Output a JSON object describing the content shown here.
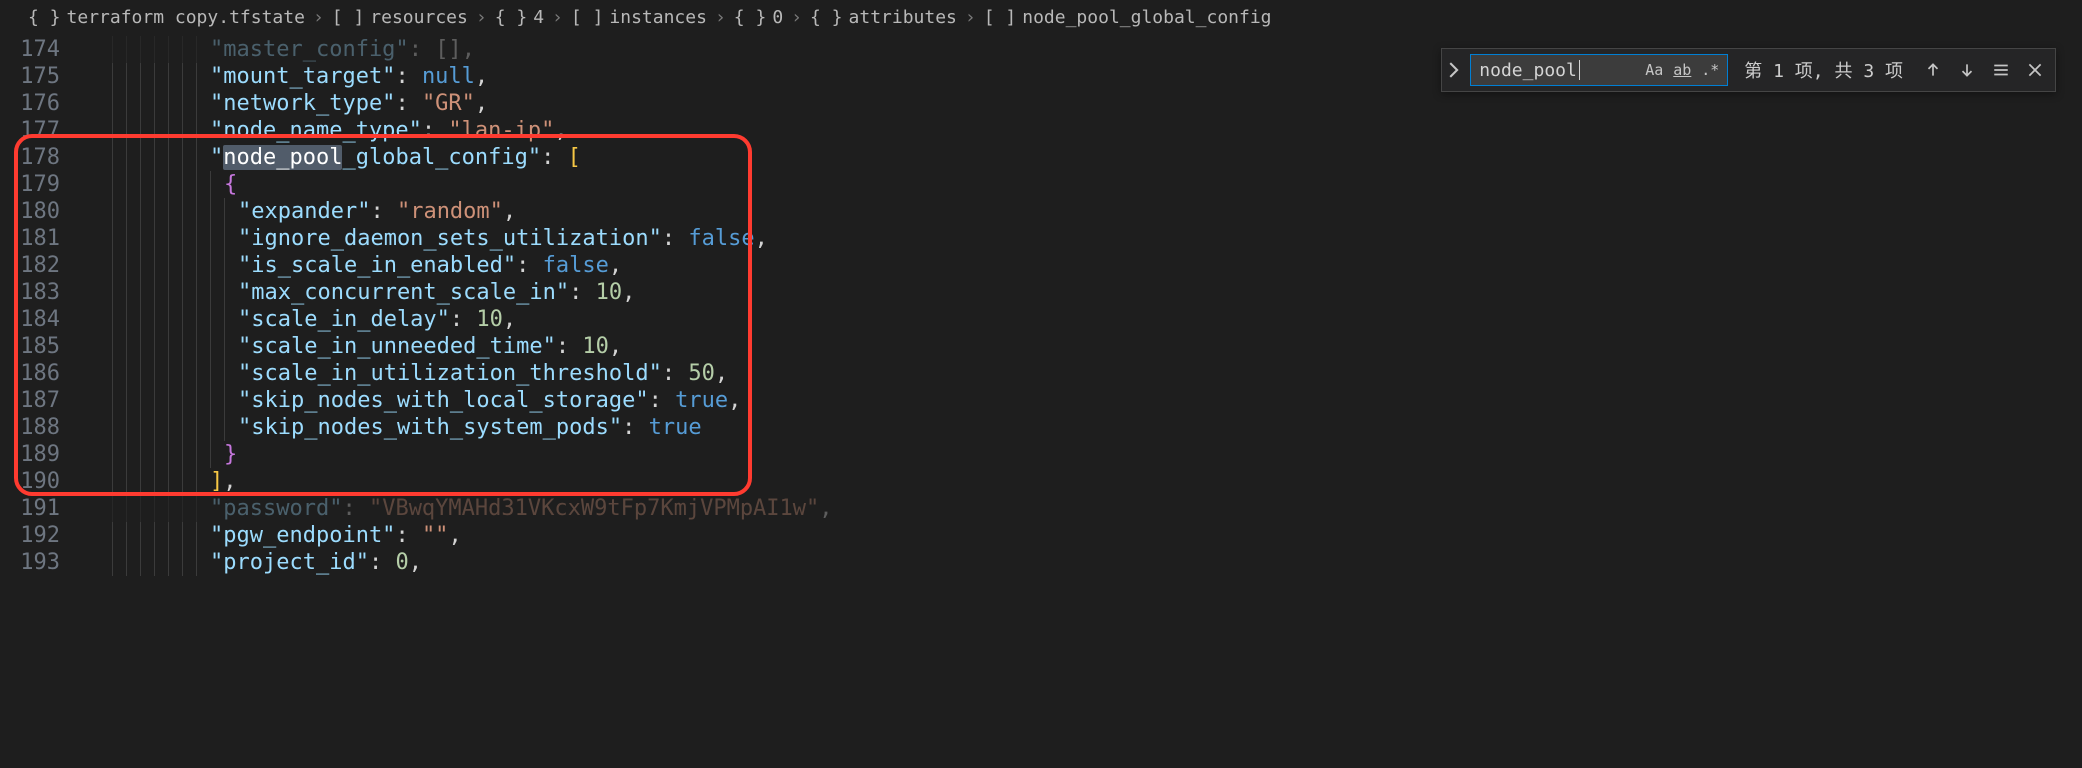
{
  "breadcrumb": [
    {
      "icon": "{ }",
      "label": "terraform copy.tfstate"
    },
    {
      "icon": "[ ]",
      "label": "resources"
    },
    {
      "icon": "{ }",
      "label": "4"
    },
    {
      "icon": "[ ]",
      "label": "instances"
    },
    {
      "icon": "{ }",
      "label": "0"
    },
    {
      "icon": "{ }",
      "label": "attributes"
    },
    {
      "icon": "[ ]",
      "label": "node_pool_global_config"
    }
  ],
  "find": {
    "value": "node_pool",
    "match_case_label": "Aa",
    "whole_word_label": "ab",
    "regex_label": ".*",
    "status": "第 1 项, 共 3 项"
  },
  "icons": {
    "expand": "chevron-right",
    "prev": "arrow-up",
    "next": "arrow-down",
    "selection": "menu",
    "close": "x"
  },
  "line_numbers": [
    "174",
    "175",
    "176",
    "177",
    "178",
    "179",
    "180",
    "181",
    "182",
    "183",
    "184",
    "185",
    "186",
    "187",
    "188",
    "189",
    "190",
    "191",
    "192",
    "193"
  ],
  "code": {
    "indent": "  ",
    "highlighted_fragment": "node_pool",
    "lines": [
      {
        "n": 174,
        "key": "master_config",
        "colon": ": ",
        "value_raw": "[]",
        "trail": ",",
        "fade": true
      },
      {
        "n": 175,
        "key": "mount_target",
        "colon": ": ",
        "value_kw": "null",
        "trail": ","
      },
      {
        "n": 176,
        "key": "network_type",
        "colon": ": ",
        "value_str": "GR",
        "trail": ","
      },
      {
        "n": 177,
        "key": "node_name_type",
        "colon": ": ",
        "value_str": "lan-ip",
        "trail": ","
      },
      {
        "n": 178,
        "key": "node_pool_global_config",
        "key_highlight_prefix": "node_pool",
        "colon": ": ",
        "open_bracket": "["
      },
      {
        "n": 179,
        "open_brace": "{",
        "extra_indent": 1
      },
      {
        "n": 180,
        "key": "expander",
        "colon": ": ",
        "value_str": "random",
        "trail": ",",
        "extra_indent": 2
      },
      {
        "n": 181,
        "key": "ignore_daemon_sets_utilization",
        "colon": ": ",
        "value_kw": "false",
        "trail": ",",
        "extra_indent": 2
      },
      {
        "n": 182,
        "key": "is_scale_in_enabled",
        "colon": ": ",
        "value_kw": "false",
        "trail": ",",
        "extra_indent": 2
      },
      {
        "n": 183,
        "key": "max_concurrent_scale_in",
        "colon": ": ",
        "value_num": "10",
        "trail": ",",
        "extra_indent": 2
      },
      {
        "n": 184,
        "key": "scale_in_delay",
        "colon": ": ",
        "value_num": "10",
        "trail": ",",
        "extra_indent": 2
      },
      {
        "n": 185,
        "key": "scale_in_unneeded_time",
        "colon": ": ",
        "value_num": "10",
        "trail": ",",
        "extra_indent": 2
      },
      {
        "n": 186,
        "key": "scale_in_utilization_threshold",
        "colon": ": ",
        "value_num": "50",
        "trail": ",",
        "extra_indent": 2
      },
      {
        "n": 187,
        "key": "skip_nodes_with_local_storage",
        "colon": ": ",
        "value_kw": "true",
        "trail": ",",
        "extra_indent": 2
      },
      {
        "n": 188,
        "key": "skip_nodes_with_system_pods",
        "colon": ": ",
        "value_kw": "true",
        "extra_indent": 2
      },
      {
        "n": 189,
        "close_brace": "}",
        "extra_indent": 1
      },
      {
        "n": 190,
        "close_bracket": "]",
        "trail": ","
      },
      {
        "n": 191,
        "key": "password",
        "colon": ": ",
        "value_str": "VBwqYMAHd31VKcxW9tFp7KmjVPMpAI1w",
        "trail": ",",
        "fade": true
      },
      {
        "n": 192,
        "key": "pgw_endpoint",
        "colon": ": ",
        "value_str": "",
        "trail": ","
      },
      {
        "n": 193,
        "key": "project_id",
        "colon": ": ",
        "value_num": "0",
        "trail": ","
      }
    ]
  }
}
